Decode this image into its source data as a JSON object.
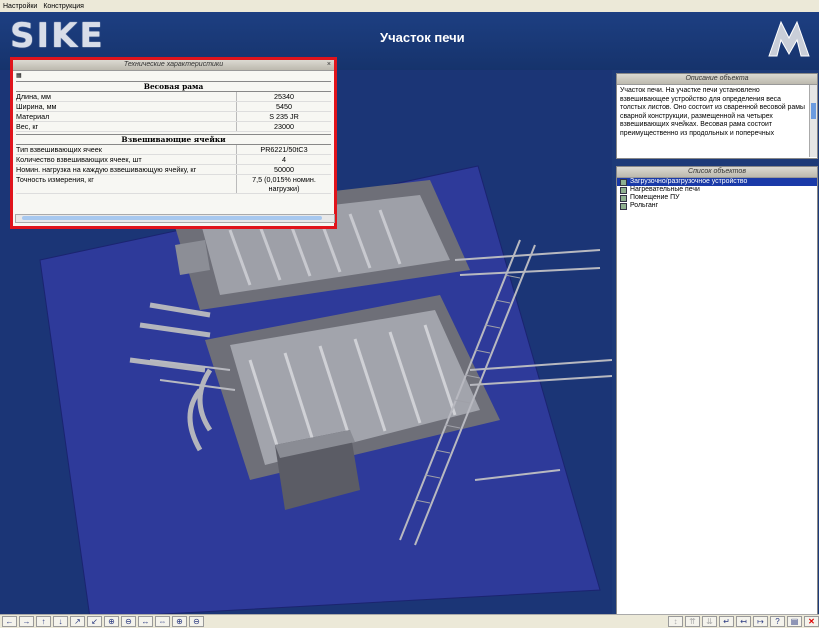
{
  "menu": [
    "Настройки",
    "Конструкция"
  ],
  "header": {
    "logo": "SIKE",
    "title": "Участок печи"
  },
  "tech_panel": {
    "title": "Технические характеристики",
    "section1": "Весовая рама",
    "rows1": [
      {
        "k": "Длина, мм",
        "v": "25340"
      },
      {
        "k": "Ширина, мм",
        "v": "5450"
      },
      {
        "k": "Материал",
        "v": "S 235 JR"
      },
      {
        "k": "Вес, кг",
        "v": "23000"
      }
    ],
    "section2": "Взвешивающие ячейки",
    "rows2": [
      {
        "k": "Тип взвешивающих ячеек",
        "v": "PR6221/50tC3"
      },
      {
        "k": "Количество взвешивающих ячеек, шт",
        "v": "4"
      },
      {
        "k": "Номин. нагрузка на каждую взвешивающую ячейку, кг",
        "v": "50000"
      },
      {
        "k": "Точность измерения, кг",
        "v": "7,5 (0,015% номин. нагрузки)"
      }
    ]
  },
  "desc_panel": {
    "title": "Описание объекта",
    "text": "Участок печи. На участке печи установлено взвешивающее устройство для определения веса толстых листов. Оно состоит из сваренной весовой рамы сварной конструкции, размещенной на четырех взвешивающих ячейках. Весовая рама состоит преимущественно из продольных и поперечных"
  },
  "list_panel": {
    "title": "Список объектов",
    "items": [
      "Загрузочно/разгрузочное устройство",
      "Нагревательные печи",
      "Помещение ПУ",
      "Рольганг"
    ]
  },
  "toolbar": [
    "←",
    "→",
    "↑",
    "↓",
    "↗",
    "↙",
    "⊕",
    "⊖",
    "↔",
    "⇔",
    "⊕",
    "⊖"
  ],
  "toolbar_right": [
    "↕",
    "⇈",
    "⇊",
    "↵",
    "↤",
    "↦",
    "?",
    "▤",
    "✕"
  ]
}
